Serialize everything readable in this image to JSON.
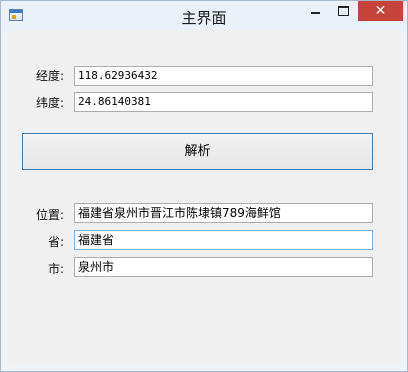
{
  "window": {
    "title": "主界面",
    "close_glyph": "✕"
  },
  "form": {
    "longitude_label": "经度:",
    "longitude_value": "118.62936432",
    "latitude_label": "纬度:",
    "latitude_value": "24.86140381",
    "parse_button_label": "解析",
    "location_label": "位置:",
    "location_value": "福建省泉州市晋江市陈埭镇789海鲜馆",
    "province_label": "省:",
    "province_value": "福建省",
    "city_label": "市:",
    "city_value": "泉州市"
  },
  "colors": {
    "close_button": "#c7443c",
    "focused_border": "#7eb4ea",
    "button_border": "#3c7fb1"
  }
}
